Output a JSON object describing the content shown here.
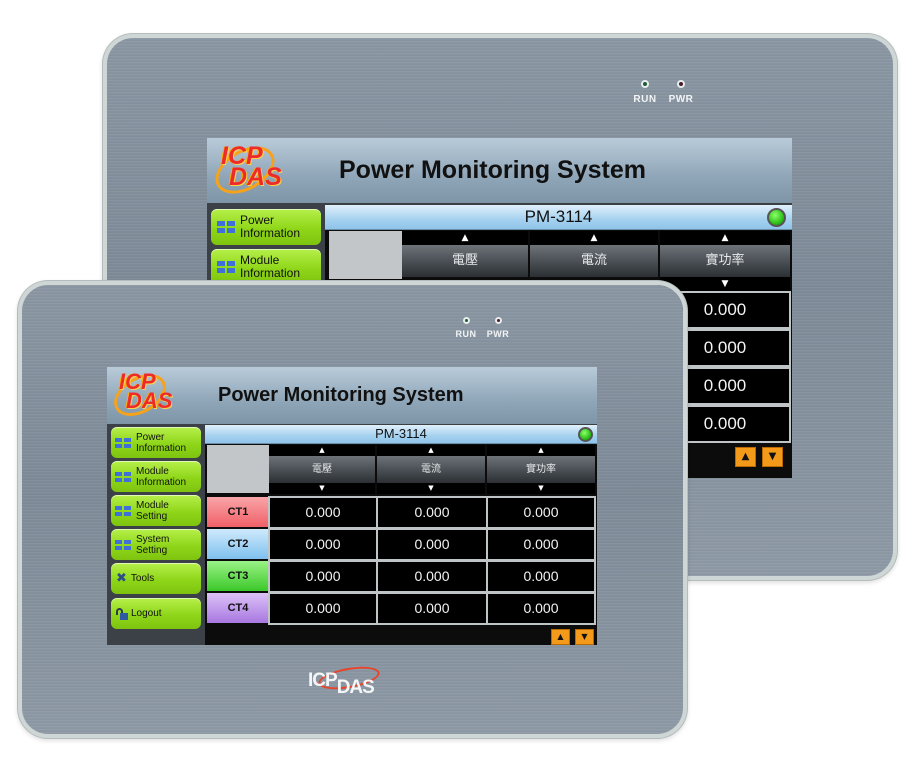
{
  "devices": {
    "back": {
      "leds": [
        {
          "label": "RUN",
          "state": "run"
        },
        {
          "label": "PWR",
          "state": "pwr"
        }
      ],
      "screen": {
        "logo": {
          "line1": "ICP",
          "line2": "DAS"
        },
        "title": "Power Monitoring System",
        "nav": [
          {
            "label_line1": "Power",
            "label_line2": "Information",
            "icon": "grid-icon"
          },
          {
            "label_line1": "Module",
            "label_line2": "Information",
            "icon": "grid-icon"
          }
        ],
        "module": "PM-3114",
        "status": "online",
        "columns": [
          {
            "label": "電壓",
            "up": "▲",
            "down": "▼"
          },
          {
            "label": "電流",
            "up": "▲",
            "down": "▼"
          },
          {
            "label": "實功率",
            "up": "▲",
            "down": "▼"
          }
        ],
        "visible_values": [
          "0.000",
          "0.000",
          "0.000",
          "0.000"
        ],
        "pager": {
          "up": "▲",
          "down": "▼"
        }
      }
    },
    "front": {
      "leds": [
        {
          "label": "RUN",
          "state": "run"
        },
        {
          "label": "PWR",
          "state": "pwr"
        }
      ],
      "brand": {
        "line1": "ICP",
        "line2": "DAS"
      },
      "screen": {
        "logo": {
          "line1": "ICP",
          "line2": "DAS"
        },
        "title": "Power Monitoring System",
        "nav": [
          {
            "label_line1": "Power",
            "label_line2": "Information",
            "icon": "grid-icon"
          },
          {
            "label_line1": "Module",
            "label_line2": "Information",
            "icon": "grid-icon"
          },
          {
            "label_line1": "Module",
            "label_line2": "Setting",
            "icon": "grid-icon"
          },
          {
            "label_line1": "System",
            "label_line2": "Setting",
            "icon": "grid-icon"
          },
          {
            "label_line1": "Tools",
            "label_line2": "",
            "icon": "tools-icon"
          },
          {
            "label_line1": "Logout",
            "label_line2": "",
            "icon": "unlock-icon"
          }
        ],
        "module": "PM-3114",
        "status": "online",
        "columns": [
          {
            "label": "電壓",
            "up": "▲",
            "down": "▼"
          },
          {
            "label": "電流",
            "up": "▲",
            "down": "▼"
          },
          {
            "label": "實功率",
            "up": "▲",
            "down": "▼"
          }
        ],
        "rows": [
          {
            "label": "CT1",
            "color": "#f2747a",
            "values": [
              "0.000",
              "0.000",
              "0.000"
            ]
          },
          {
            "label": "CT2",
            "color": "#8cc8f2",
            "values": [
              "0.000",
              "0.000",
              "0.000"
            ]
          },
          {
            "label": "CT3",
            "color": "#5fe04a",
            "values": [
              "0.000",
              "0.000",
              "0.000"
            ]
          },
          {
            "label": "CT4",
            "color": "#b88ae8",
            "values": [
              "0.000",
              "0.000",
              "0.000"
            ]
          }
        ],
        "pager": {
          "up": "▲",
          "down": "▼"
        }
      }
    }
  }
}
